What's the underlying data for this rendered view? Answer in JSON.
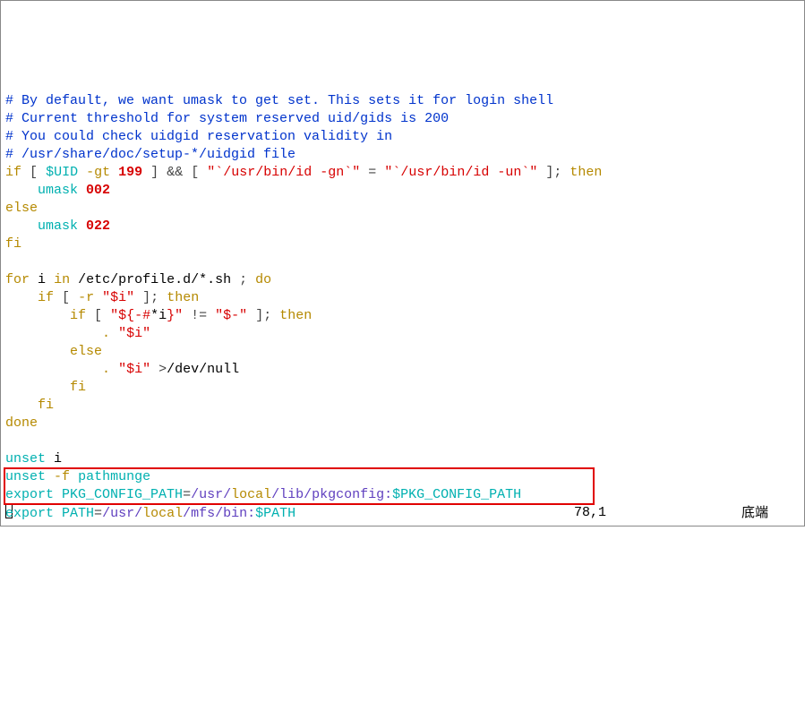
{
  "comments": {
    "l1": "# By default, we want umask to get set. This sets it for login shell",
    "l2": "# Current threshold for system reserved uid/gids is 200",
    "l3": "# You could check uidgid reservation validity in",
    "l4": "# /usr/share/doc/setup-*/uidgid file"
  },
  "code": {
    "if": "if",
    "lbr": "[",
    "rbr": "]",
    "uid": "$UID",
    "gt": "-gt",
    "n199": "199",
    "and": "&&",
    "gn": "\"`/usr/bin/id -gn`\"",
    "eq": "=",
    "un": "\"`/usr/bin/id -un`\"",
    "semi": ";",
    "then": "then",
    "umask": "umask",
    "n002": "002",
    "else": "else",
    "n022": "022",
    "fi": "fi",
    "for": "for",
    "i": "i",
    "in": "in",
    "profpath": "/etc/profile.d/*.sh ",
    "do": "do",
    "r": "-r",
    "si": "\"$i\"",
    "param": "\"${-#",
    "star_i": "*i",
    "param_end": "}\"",
    "neq": "!=",
    "dash": "\"$-\"",
    "dot": ".",
    "redir": ">",
    "devnull": "/dev/null",
    "done": "done",
    "unset": "unset",
    "unset_f": "-f",
    "pathmunge": "pathmunge",
    "export": "export",
    "pkgvar": "PKG_CONFIG_PATH",
    "pkgeq": "=",
    "usr": "/usr/",
    "local": "local",
    "libpkg": "/lib/pkgconfig:",
    "pkgref": "$PKG_CONFIG_PATH",
    "pathvar": "PATH",
    "mfsbin": "/mfs/bin:",
    "pathref": "$PATH"
  },
  "status": {
    "pos": "78,1",
    "loc": "底端"
  }
}
